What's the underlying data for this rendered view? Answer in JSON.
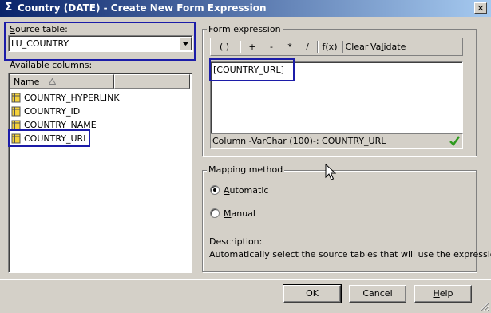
{
  "window": {
    "title": "Country (DATE) - Create New Form Expression",
    "title_icon": "Σ",
    "close_glyph": "✕"
  },
  "source_table": {
    "label_prefix": "S",
    "label_rest": "ource table:",
    "value": "LU_COUNTRY"
  },
  "available_columns": {
    "label_prefix": "Available ",
    "label_u": "c",
    "label_rest": "olumns:",
    "header": "Name",
    "items": [
      "COUNTRY_HYPERLINK",
      "COUNTRY_ID",
      "COUNTRY_NAME",
      "COUNTRY_URL"
    ]
  },
  "form_expression": {
    "label": "Form expression",
    "toolbar": {
      "parens": "( )",
      "plus": "+",
      "minus": "-",
      "times": "*",
      "divide": "/",
      "fx": "f(x)",
      "clear": "Clear",
      "validate_pre": "Va",
      "validate_u": "l",
      "validate_post": "idate"
    },
    "text": "[COUNTRY_URL]",
    "status": "Column -VarChar (100)-: COUNTRY_URL",
    "status_icon": "checkmark-icon"
  },
  "mapping": {
    "label": "Mapping method",
    "automatic_u": "A",
    "automatic_rest": "utomatic",
    "manual_u": "M",
    "manual_rest": "anual",
    "selected": "automatic",
    "description_label": "Description:",
    "description_text": "Automatically select the source tables that will use the expression."
  },
  "buttons": {
    "ok": "OK",
    "cancel": "Cancel",
    "help_u": "H",
    "help_rest": "elp"
  },
  "colors": {
    "accent_highlight": "#1c1ca8",
    "titlebar_start": "#0a246a",
    "check_green": "#2e9a1e"
  }
}
